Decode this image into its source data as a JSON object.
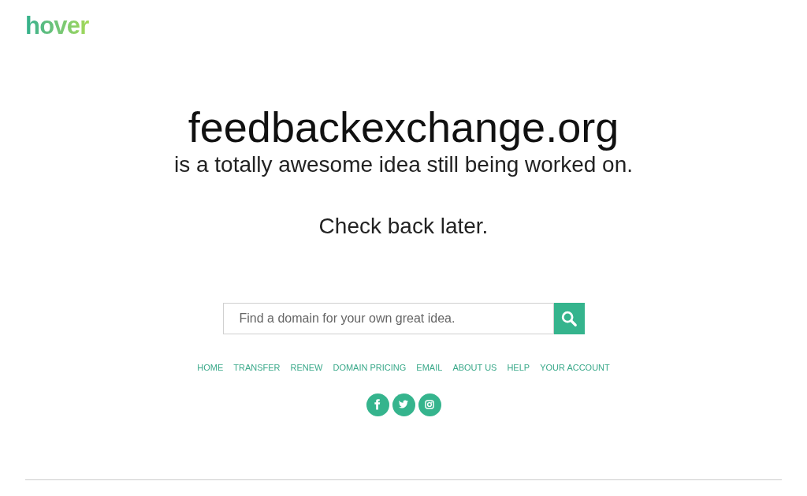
{
  "logo": {
    "text": "hover"
  },
  "headline": {
    "domain": "feedbackexchange.org",
    "tagline": "is a totally awesome idea still being worked on.",
    "note": "Check back later."
  },
  "search": {
    "placeholder": "Find a domain for your own great idea."
  },
  "nav_links": [
    "HOME",
    "TRANSFER",
    "RENEW",
    "DOMAIN PRICING",
    "EMAIL",
    "ABOUT US",
    "HELP",
    "YOUR ACCOUNT"
  ],
  "social_links": [
    {
      "kind": "facebook"
    },
    {
      "kind": "twitter"
    },
    {
      "kind": "instagram"
    }
  ]
}
